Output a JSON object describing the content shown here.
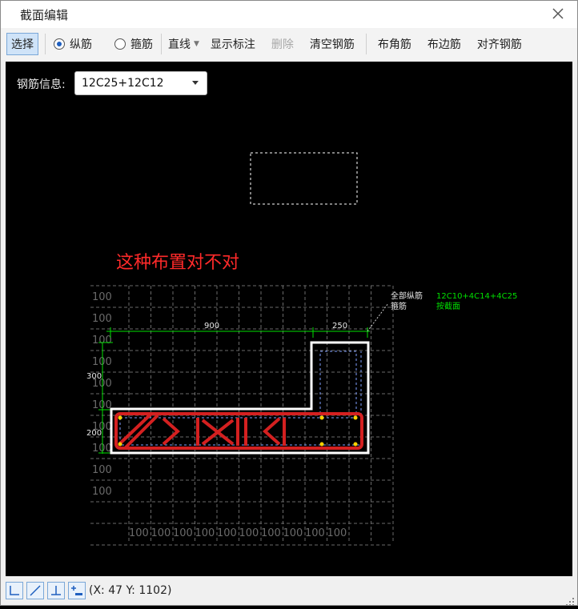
{
  "window": {
    "title": "截面编辑"
  },
  "toolbar": {
    "select_label": "选择",
    "radio_longitudinal": "纵筋",
    "radio_stirrup": "箍筋",
    "selected_radio": "纵筋",
    "line_mode": "直线",
    "show_annotation": "显示标注",
    "delete": "删除",
    "clear_rebar": "清空钢筋",
    "corner_rebar": "布角筋",
    "edge_rebar": "布边筋",
    "align_rebar": "对齐钢筋"
  },
  "rebar_info": {
    "label": "钢筋信息:",
    "value": "12C25+12C12"
  },
  "annotation": {
    "question": "这种布置对不对"
  },
  "dimensions": {
    "top_left": "900",
    "top_right": "250",
    "left_upper": "300",
    "left_lower": "200",
    "grid_step": "100"
  },
  "callout": {
    "line1_label": "全部纵筋",
    "line1_value": "12C10+4C14+4C25",
    "line2_label": "箍筋",
    "line2_value": "按截面"
  },
  "status": {
    "coords": "(X: 47 Y: 1102)"
  },
  "icons": {
    "snap_1": "ortho-corner-icon",
    "snap_2": "diagonal-line-icon",
    "snap_3": "perpendicular-icon",
    "snap_4": "add-point-icon"
  },
  "colors": {
    "dimension": "#00e000",
    "outline": "#ffffff",
    "markup": "#e02020",
    "grid": "#6a6a6a"
  }
}
